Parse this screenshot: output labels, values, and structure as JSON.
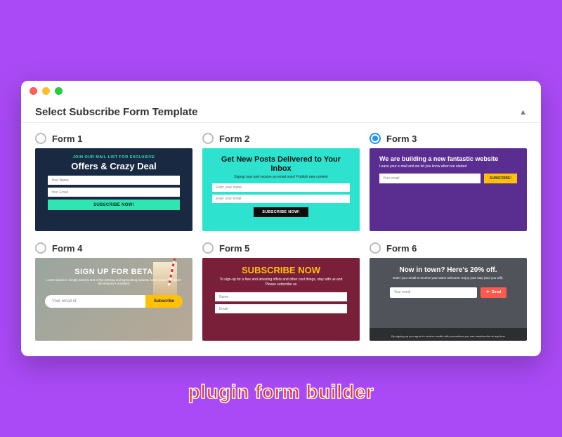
{
  "header": {
    "title": "Select Subscribe Form Template"
  },
  "selected_form_index": 2,
  "caption": "plugin form builder",
  "forms": [
    {
      "label": "Form 1",
      "preview": {
        "eyebrow": "JOIN OUR MAIL LIST FOR EXCLUSIVE",
        "heading": "Offers & Crazy Deal",
        "fields": [
          "Your Name",
          "Your Email"
        ],
        "button": "SUBSCRIBE NOW!"
      }
    },
    {
      "label": "Form 2",
      "preview": {
        "heading": "Get New  Posts Delivered to Your Inbox",
        "sub": "Signup now and receive an email once! Publish new content",
        "fields": [
          "Enter your name",
          "Enter your email"
        ],
        "button": "SUBSCRIBE NOW!"
      }
    },
    {
      "label": "Form 3",
      "preview": {
        "heading": "We are building a new fantastic website",
        "sub": "Leave your e-mail and we let you know when we started",
        "field": "Your email",
        "button": "SUBSCRIBE!"
      }
    },
    {
      "label": "Form 4",
      "preview": {
        "heading": "SIGN UP FOR BETA",
        "sub": "Lorem ipsum is simply dummy text of the printing and typesetting industry lorem ipsum has been the industry's standard",
        "field": "Your email id",
        "button": "Subscribe"
      }
    },
    {
      "label": "Form 5",
      "preview": {
        "heading": "SUBSCRIBE NOW",
        "sub": "To sign-up for a free and amazing offers and other cool things, stay with us and Please subscribe us",
        "fields": [
          "Name",
          "Email"
        ]
      }
    },
    {
      "label": "Form 6",
      "preview": {
        "heading": "Now in town? Here's 20% off.",
        "sub": "Enter your email to receive your warm welcome. Enjoy your stay (and you will).",
        "field": "Your email",
        "button": "Send",
        "footer": "By signing up you agree to receive emails with promotions you can unsubscribe at any time"
      }
    }
  ]
}
